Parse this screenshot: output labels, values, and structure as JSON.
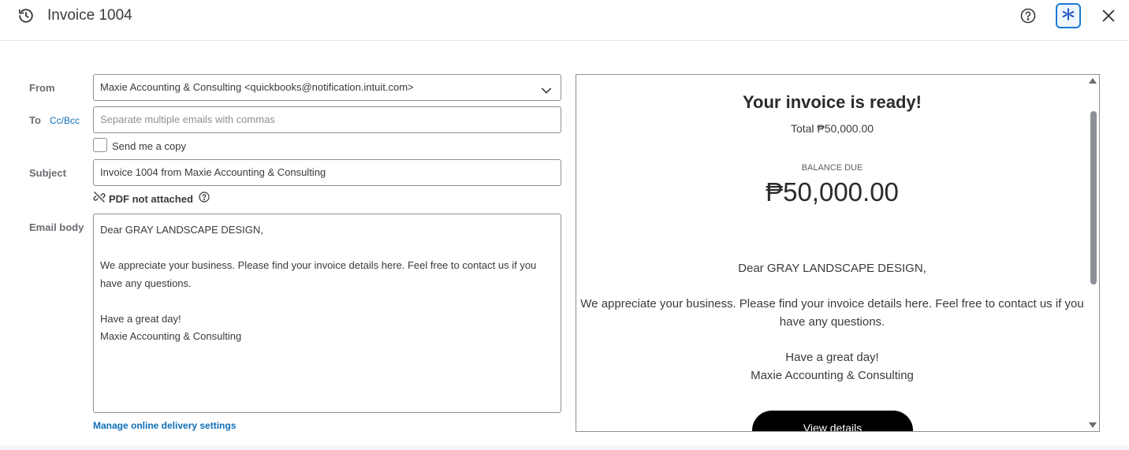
{
  "header": {
    "title": "Invoice 1004"
  },
  "form": {
    "from_label": "From",
    "from_value": "Maxie Accounting & Consulting <quickbooks@notification.intuit.com>",
    "to_label": "To",
    "cc_bcc_label": "Cc/Bcc",
    "to_placeholder": "Separate multiple emails with commas",
    "send_copy_label": "Send me a copy",
    "subject_label": "Subject",
    "subject_value": "Invoice 1004 from Maxie Accounting & Consulting",
    "pdf_status": "PDF not attached",
    "email_body_label": "Email body",
    "email_body": {
      "greeting": "Dear GRAY LANDSCAPE DESIGN,",
      "message_line1": "We appreciate your business. Please find your invoice details here. Feel free to contact us if you",
      "message_line2": "have any questions.",
      "closing": "Have a great day!",
      "signature": "Maxie Accounting & Consulting"
    },
    "manage_link": "Manage online delivery settings"
  },
  "preview": {
    "heading": "Your invoice is ready!",
    "total": "Total ₱50,000.00",
    "balance_label": "BALANCE DUE",
    "balance_amount": "₱50,000.00",
    "greeting": "Dear GRAY LANDSCAPE DESIGN,",
    "message_line1": "We appreciate your business. Please find your invoice details here. Feel free to contact us if you",
    "message_line2": "have any questions.",
    "closing": "Have a great day!",
    "signature": "Maxie Accounting & Consulting",
    "button_label": "View details"
  },
  "colors": {
    "link": "#0d6fb8",
    "ai_accent": "#1a7ad6",
    "text": "#393a3d"
  },
  "icons": [
    "history-icon",
    "help-icon",
    "ai-assist-icon",
    "close-icon",
    "chevron-down-icon",
    "unlink-icon",
    "info-icon"
  ]
}
